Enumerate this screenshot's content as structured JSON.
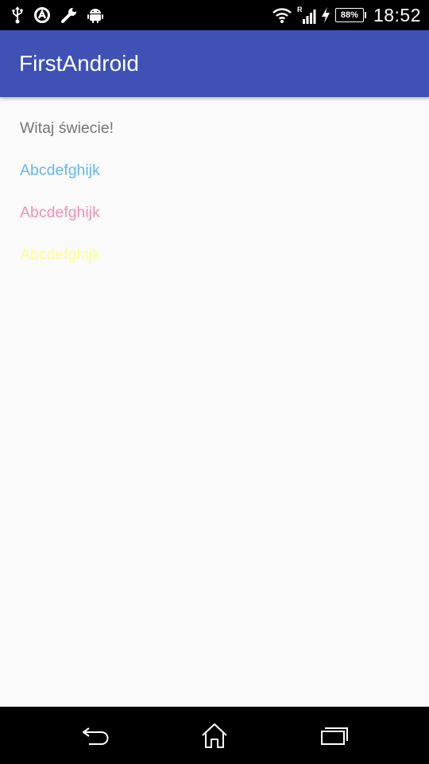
{
  "status_bar": {
    "time": "18:52",
    "battery": "88%",
    "signal_roaming": "R",
    "left_icons": [
      "usb-icon",
      "app-notification-icon",
      "wrench-icon",
      "android-debug-icon"
    ],
    "right_icons": [
      "wifi-icon",
      "cell-signal-icon",
      "charging-icon",
      "battery-icon"
    ]
  },
  "app_bar": {
    "title": "FirstAndroid",
    "color": "#3f51b5"
  },
  "content": {
    "greeting": {
      "text": "Witaj świecie!",
      "color": "#757575"
    },
    "lines": [
      {
        "text": "Abcdefghijk",
        "color": "#64b5f6"
      },
      {
        "text": "Abcdefghijk",
        "color": "#f48fb1"
      },
      {
        "text": "Abcdefghijk",
        "color": "#ffff8d"
      }
    ]
  },
  "nav_bar": {
    "buttons": [
      "back-icon",
      "home-icon",
      "recents-icon"
    ]
  }
}
